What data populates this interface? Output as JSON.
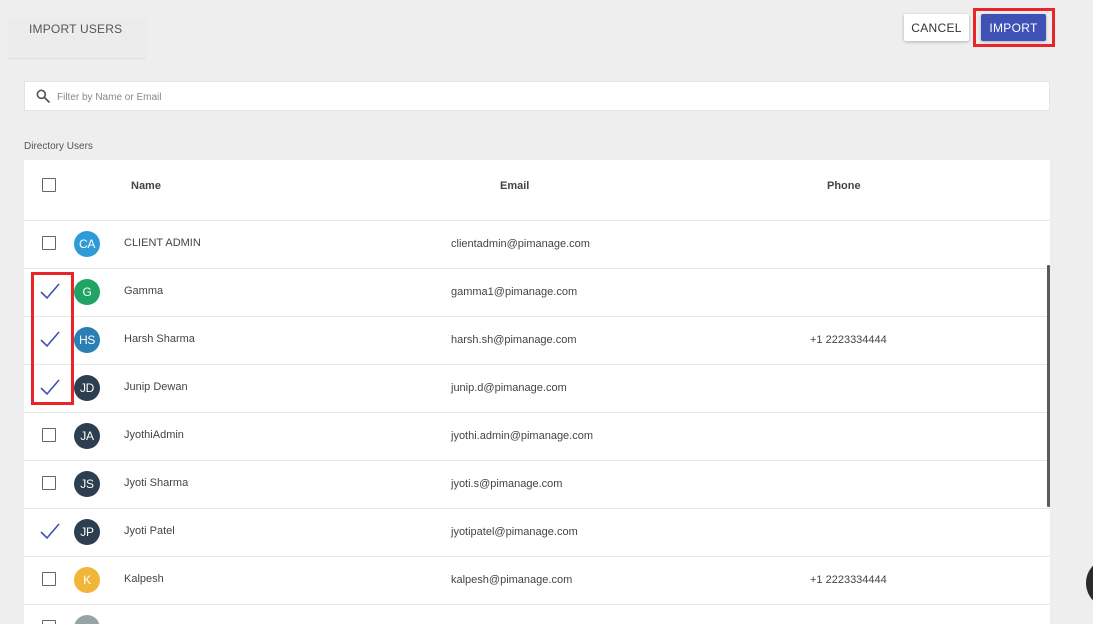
{
  "header": {
    "title": "IMPORT USERS",
    "cancel_label": "CANCEL",
    "import_label": "IMPORT"
  },
  "search": {
    "placeholder": "Filter by Name or Email",
    "value": ""
  },
  "section_title": "Directory Users",
  "table": {
    "columns": [
      "Name",
      "Email",
      "Phone"
    ],
    "rows": [
      {
        "initials": "CA",
        "name": "CLIENT ADMIN",
        "email": "clientadmin@pimanage.com",
        "phone": "",
        "checked": false,
        "avatar_color": "#2e9bd6"
      },
      {
        "initials": "G",
        "name": "Gamma",
        "email": "gamma1@pimanage.com",
        "phone": "",
        "checked": true,
        "avatar_color": "#1fa463"
      },
      {
        "initials": "HS",
        "name": "Harsh Sharma",
        "email": "harsh.sh@pimanage.com",
        "phone": "+1 2223334444",
        "checked": true,
        "avatar_color": "#2a7fb5"
      },
      {
        "initials": "JD",
        "name": "Junip Dewan",
        "email": "junip.d@pimanage.com",
        "phone": "",
        "checked": true,
        "avatar_color": "#2c3e50"
      },
      {
        "initials": "JA",
        "name": "JyothiAdmin",
        "email": "jyothi.admin@pimanage.com",
        "phone": "",
        "checked": false,
        "avatar_color": "#2c3e50"
      },
      {
        "initials": "JS",
        "name": "Jyoti Sharma",
        "email": "jyoti.s@pimanage.com",
        "phone": "",
        "checked": false,
        "avatar_color": "#2c3e50"
      },
      {
        "initials": "JP",
        "name": "Jyoti Patel",
        "email": "jyotipatel@pimanage.com",
        "phone": "",
        "checked": true,
        "avatar_color": "#2c3e50"
      },
      {
        "initials": "K",
        "name": "Kalpesh",
        "email": "kalpesh@pimanage.com",
        "phone": "+1 2223334444",
        "checked": false,
        "avatar_color": "#f0b63a"
      },
      {
        "initials": "",
        "name": "",
        "email": "",
        "phone": "",
        "checked": false,
        "avatar_color": "#95a5a6"
      }
    ]
  },
  "colors": {
    "primary": "#3f51b5",
    "highlight": "#e8262a",
    "checkmark": "#3f51b5"
  }
}
